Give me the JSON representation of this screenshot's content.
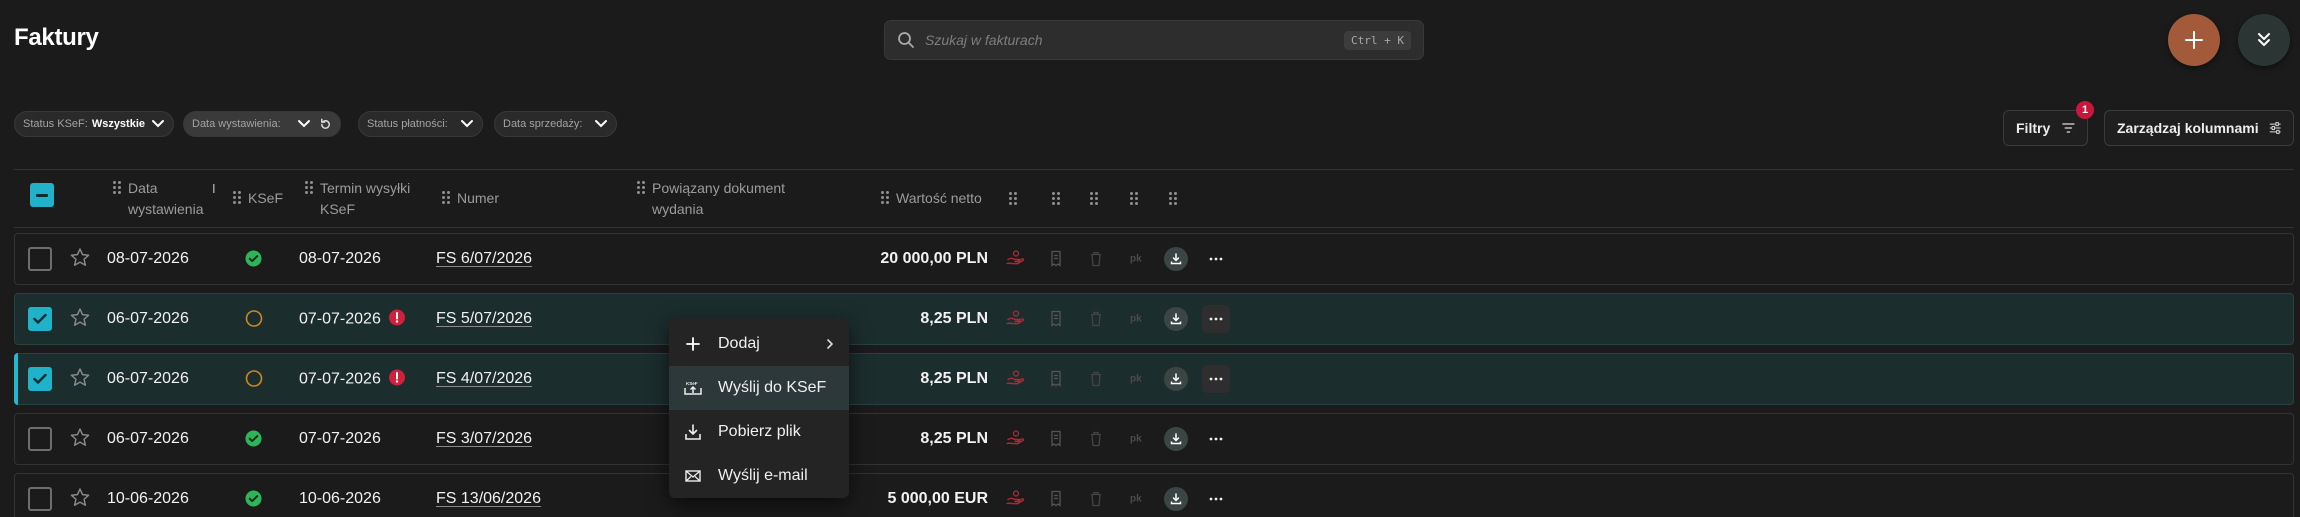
{
  "page": {
    "title": "Faktury"
  },
  "search": {
    "placeholder": "Szukaj w fakturach",
    "shortcut": "Ctrl + K"
  },
  "filters": {
    "chips": [
      {
        "label": "Status KSeF:",
        "value": "Wszystkie"
      },
      {
        "label": "Data wystawienia:",
        "value": ""
      },
      {
        "label": "Status płatności:",
        "value": ""
      },
      {
        "label": "Data sprzedaży:",
        "value": ""
      }
    ],
    "filters_button": "Filtry",
    "filters_count": "1",
    "manage_columns": "Zarządzaj kolumnami"
  },
  "table": {
    "columns": {
      "issue_date": "Data wystawienia",
      "ksef": "KSeF",
      "ksef_deadline": "Termin wysyłki KSeF",
      "number": "Numer",
      "related_doc": "Powiązany dokument wydania",
      "net_value": "Wartość netto"
    },
    "rows": [
      {
        "checked": false,
        "issue_date": "08-07-2026",
        "ksef_status": "sent",
        "deadline": "08-07-2026",
        "warning": false,
        "number": "FS 6/07/2026",
        "net": "20 000,00 PLN"
      },
      {
        "checked": true,
        "issue_date": "06-07-2026",
        "ksef_status": "pending",
        "deadline": "07-07-2026",
        "warning": true,
        "number": "FS 5/07/2026",
        "net": "8,25 PLN"
      },
      {
        "checked": true,
        "issue_date": "06-07-2026",
        "ksef_status": "pending",
        "deadline": "07-07-2026",
        "warning": true,
        "number": "FS 4/07/2026",
        "net": "8,25 PLN"
      },
      {
        "checked": false,
        "issue_date": "06-07-2026",
        "ksef_status": "sent",
        "deadline": "07-07-2026",
        "warning": false,
        "number": "FS 3/07/2026",
        "net": "8,25 PLN"
      },
      {
        "checked": false,
        "issue_date": "10-06-2026",
        "ksef_status": "sent",
        "deadline": "10-06-2026",
        "warning": false,
        "number": "FS 13/06/2026",
        "net": "5 000,00 EUR"
      }
    ],
    "row_action_icons": [
      "payment-hand-icon",
      "receipt-icon",
      "delete-icon",
      "pk-icon",
      "download-icon",
      "more-icon"
    ],
    "pk_label": "pk"
  },
  "context_menu": {
    "items": [
      {
        "label": "Dodaj",
        "icon": "plus-icon",
        "submenu": true
      },
      {
        "label": "Wyślij do KSeF",
        "icon": "ksef-send-icon",
        "submenu": false
      },
      {
        "label": "Pobierz plik",
        "icon": "download-icon",
        "submenu": false
      },
      {
        "label": "Wyślij e-mail",
        "icon": "mail-icon",
        "submenu": false
      }
    ]
  },
  "colors": {
    "accent": "#1fb2c9",
    "fab_add": "#a25a3a",
    "success": "#2fb45a",
    "pending": "#c88a1e",
    "warning": "#d0203c",
    "badge": "#c8173b"
  }
}
